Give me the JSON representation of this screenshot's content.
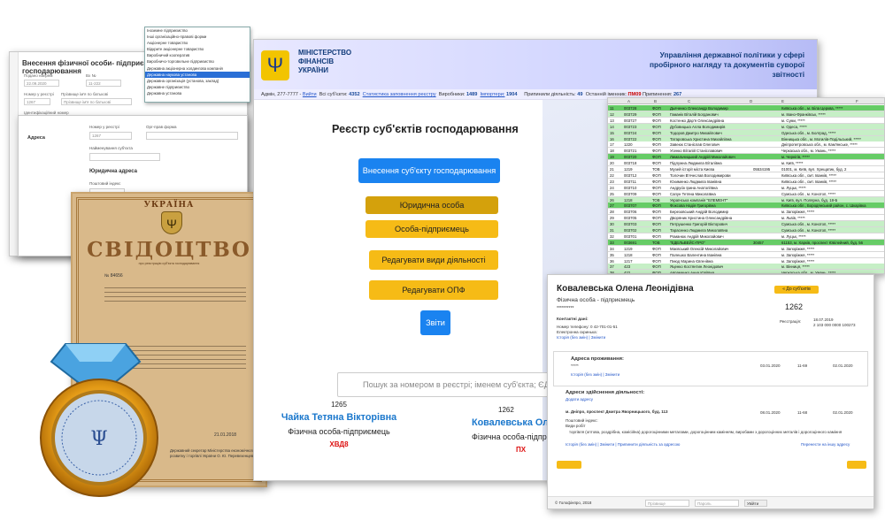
{
  "form_window": {
    "title": "Внесення фізичної особи- підприємця до реєстру суб'єктів господарювання",
    "fields": [
      {
        "label": "Подано напрям",
        "value": "22.09.2020"
      },
      {
        "label": "Вх №",
        "value": "11-222"
      },
      {
        "label": "Номер у реєстрі",
        "value": "1267"
      },
      {
        "label": "Прізвище ім'я по батькові",
        "value": "Прізвище ім'я по батькові"
      },
      {
        "label": "Ідентифікаційний номер",
        "value": "Серія, номер паспорту або УНЗР, ким виданий"
      }
    ]
  },
  "form_window2": {
    "registry_label": "Номер у реєстрі",
    "registry_value": "1267",
    "org_form_label": "Орг-прав форма",
    "address_label": "Адреса",
    "name_label": "Найменування суб'єкта",
    "legal_address": "Юридична адреса",
    "postal_index": "Поштовий індекс",
    "dropdown_options": [
      "Іноземне підприємство",
      "Інші організаційно-правові форми",
      "Акціонерне товариство",
      "Відкрите акціонерне товариство",
      "Виробничий кооператив",
      "Виробничо-торговельне підприємство",
      "Державна акціонерна холдингова компанія",
      "Державна наукова установа",
      "Державна організація (установа, заклад)",
      "Державне підприємство",
      "Державна установа"
    ],
    "selected_index": 7
  },
  "certificate": {
    "country": "УКРАЇНА",
    "title": "СВІДОЦТВО",
    "subtitle": "про реєстрацію суб'єкта господарювання",
    "number": "№ 84656",
    "date": "21.01.2018",
    "signatory": "Державний секретар Міністерства економічного розвитку і торгівлі України О. Ю. Перевезенцев"
  },
  "main_window": {
    "ministry": "МІНІСТЕРСТВО ФІНАНСІВ УКРАЇНИ",
    "department": "Управління державної політики у сфері пробірного нагляду та документів суворої звітності",
    "status": {
      "admin_label": "Адмін, 277-7777 -",
      "logout": "Вийти",
      "entities_label": "Всі суб'єкти:",
      "entities_count": "4352",
      "stats_link": "Статистика заповнення реєстру",
      "producers_label": "Виробники:",
      "producers_count": "1489",
      "importers_label": "Імпортери:",
      "importers_count": "1904",
      "suspended_label": "Припинили діяльність:",
      "suspended_count": "49",
      "last_label": "Останній іменник:",
      "last_value": "ПМ09",
      "terminated_label": "Припинення:",
      "terminated_count": "267"
    },
    "page_title": "Реєстр суб'єктів господарювання",
    "buttons": {
      "add_entity": "Внесення суб'єкту господарювання",
      "legal_entity": "Юридична особа",
      "individual": "Особа-підприємець",
      "edit_activities": "Редагувати види діяльності",
      "edit_opf": "Редагувати ОПФ",
      "reports": "Звіти"
    },
    "search_placeholder": "Пошук за номером в реєстрі; іменем суб'єкта; ЄДРП",
    "cards": [
      {
        "id": "1265",
        "name": "Чайка Тетяна Вікторівна",
        "type": "Фізична особа-підприємець",
        "code": "ХВД8"
      },
      {
        "id": "1262",
        "name": "Ковалевська Олена Ле",
        "type": "Фізична особа-підприєм",
        "code": "ПХ"
      }
    ]
  },
  "spreadsheet": {
    "columns": [
      "A",
      "B",
      "C",
      "D",
      "E",
      "F"
    ],
    "rows": [
      {
        "n": "11",
        "id": "003728",
        "form": "ФОП",
        "name": "Дьяченко Олександр Володимир",
        "code": "",
        "addr": "Київська обл., м. Біла Церква, *****",
        "c": "g"
      },
      {
        "n": "12",
        "id": "003729",
        "form": "ФОП",
        "name": "Гаманік Віталій Богданович",
        "code": "",
        "addr": "м. Івано-Франківськ, *****",
        "c": "lg"
      },
      {
        "n": "13",
        "id": "003727",
        "form": "ФОП",
        "name": "Костенко Дар'я Олександрівна",
        "code": "",
        "addr": "м. Суми, *****",
        "c": "w"
      },
      {
        "n": "14",
        "id": "003723",
        "form": "ФОП",
        "name": "Дубовицька Алла Володимирів",
        "code": "",
        "addr": "м. Одеса, *****",
        "c": "lg"
      },
      {
        "n": "15",
        "id": "003724",
        "form": "ФОП",
        "name": "Тодоров Дмитро Михайлович",
        "code": "",
        "addr": "Одеська обл., м. Болград, *****",
        "c": "lg"
      },
      {
        "n": "16",
        "id": "003722",
        "form": "ФОП",
        "name": "Татаровська Христина Михайлівна",
        "code": "",
        "addr": "Вінницька обл., м. Могилів-Подільський, *****",
        "c": "lg"
      },
      {
        "n": "17",
        "id": "1220",
        "form": "ФОП",
        "name": "Завеюк Станіслав Олегович",
        "code": "",
        "addr": "Дніпропетровська обл., м. Кам'янське, *****",
        "c": "w"
      },
      {
        "n": "18",
        "id": "003721",
        "form": "ФОП",
        "name": "Усенко Віталій Станіславович",
        "code": "",
        "addr": "Черкаська обл., м. Умань, *****",
        "c": "w"
      },
      {
        "n": "19",
        "id": "003720",
        "form": "ФОП",
        "name": "Лимальчицький Андрій Миколайович",
        "code": "",
        "addr": "м. Чернігів, *****",
        "c": "g"
      },
      {
        "n": "20",
        "id": "003718",
        "form": "ФОП",
        "name": "Підлужна Людмила Віталівна",
        "code": "",
        "addr": "м. Київ, *****",
        "c": "w"
      },
      {
        "n": "21",
        "id": "1219",
        "form": "ТОВ",
        "name": "Музей історії міста Києва",
        "code": "05534195",
        "addr": "01001, м. Київ, вул. Хрещатик, буд. 2",
        "c": "w"
      },
      {
        "n": "22",
        "id": "003712",
        "form": "ФОП",
        "name": "Толочин В'ячеслав Володимирови",
        "code": "",
        "addr": "Київська обл., смт. Іванків, *****",
        "c": "w"
      },
      {
        "n": "23",
        "id": "003711",
        "form": "ФОП",
        "name": "Юхименко Людмила Іванівна",
        "code": "",
        "addr": "Київська обл., смт. Іванків, *****",
        "c": "w"
      },
      {
        "n": "24",
        "id": "003710",
        "form": "ФОП",
        "name": "Андрусік Ірина Анатоліївна",
        "code": "",
        "addr": "м. Луцьк, *****",
        "c": "w"
      },
      {
        "n": "25",
        "id": "003709",
        "form": "ФОП",
        "name": "Сапун Тетяна Миколаївна",
        "code": "",
        "addr": "Сумська обл., м. Конотоп, *****",
        "c": "w"
      },
      {
        "n": "26",
        "id": "1218",
        "form": "ТОВ",
        "name": "Українська компанія \"ЕЛЕМЕНТ\"",
        "code": "",
        "addr": "м. Київ, вул. Полярна, буд. 18-Б",
        "c": "lg"
      },
      {
        "n": "27",
        "id": "003707",
        "form": "ФОП",
        "name": "Фоксова Надія Григорівна",
        "code": "",
        "addr": "Київська обл., Бородянський район, с. Шкарівка",
        "c": "g"
      },
      {
        "n": "28",
        "id": "003706",
        "form": "ФОП",
        "name": "Березовський Андрій Володимир",
        "code": "",
        "addr": "м. Запоріжжя, *****",
        "c": "w"
      },
      {
        "n": "29",
        "id": "003705",
        "form": "ФОП",
        "name": "Дворяник Христина Олександрівна",
        "code": "",
        "addr": "м. Львів, *****",
        "c": "w"
      },
      {
        "n": "30",
        "id": "003703",
        "form": "ФОП",
        "name": "Петрушенко Григорій Вікторович",
        "code": "",
        "addr": "Сумська обл., м. Конотоп, *****",
        "c": "lg"
      },
      {
        "n": "31",
        "id": "003702",
        "form": "ФОП",
        "name": "Тарасенко Людмила Миколаївна",
        "code": "",
        "addr": "Сумська обл., м. Конотоп, *****",
        "c": "lg"
      },
      {
        "n": "32",
        "id": "003701",
        "form": "ФОП",
        "name": "Романюк Андрій Миколайович",
        "code": "",
        "addr": "м. Луцьк, *****",
        "c": "w"
      },
      {
        "n": "33",
        "id": "003691",
        "form": "ТОВ",
        "name": "\"ЕДЕЛЬВЕЙС-ПРО\"",
        "code": "30457",
        "addr": "61153, м. Харків, проспект Ювілейний, буд. 56",
        "c": "g"
      },
      {
        "n": "34",
        "id": "1219",
        "form": "ФОП",
        "name": "Маєвський Олексій Миколайович",
        "code": "",
        "addr": "м. Запоріжжя, *****",
        "c": "w"
      },
      {
        "n": "35",
        "id": "1218",
        "form": "ФОП",
        "name": "Палешко Валентина Іванівна",
        "code": "",
        "addr": "м. Запоріжжя, *****",
        "c": "w"
      },
      {
        "n": "36",
        "id": "1217",
        "form": "ФОП",
        "name": "Пиюд Марина Євгенівна",
        "code": "",
        "addr": "м. Запоріжжя, *****",
        "c": "w"
      },
      {
        "n": "37",
        "id": "423",
        "form": "ФОП",
        "name": "Яценко Костянтин Леонідович",
        "code": "",
        "addr": "м. Вінниця, *****",
        "c": "lg"
      },
      {
        "n": "38",
        "id": "422",
        "form": "ФОП",
        "name": "Авраменко Анна Юріївна",
        "code": "",
        "addr": "Черкаська обл., м. Умань, *****",
        "c": "lg"
      }
    ]
  },
  "detail_card": {
    "name": "Ковалевська Олена Леонідівна",
    "type": "Фізична особа - підприємець",
    "masked": "**********",
    "all_entities_btn": "« До суб'єктів",
    "number": "1262",
    "contacts_label": "Контактні дані:",
    "phone": "Номер телефону: 0 42-701-01-51",
    "email_label": "Електронна скринька:",
    "history_links": "Історія (без змін) | Змінити",
    "registry_label": "Реєстрація:",
    "registry_date": "18.07.2019",
    "registry_code": "2 103 000 0000 100273",
    "residence_label": "Адреса проживання:",
    "residence_value": "*****",
    "residence_date1": "03.01.2020",
    "residence_code": "11-69",
    "residence_date2": "02.01.2020",
    "activity_label": "Адреси здійснення діяльності:",
    "add_address": "Додати адресу",
    "activity_addr": "м. Дніпро, проспект Дмитра Яворницького, буд. 113",
    "activity_date1": "08.01.2020",
    "activity_code": "11-68",
    "activity_date2": "02.01.2020",
    "index_label": "Поштовий індекс:",
    "kinds_label": "Види робіт",
    "kinds_value": "торгівля (оптова, роздрібна, комісійна) дорогоцінними металами, дорогоцінним камінням, виробами з дорогоцінних металів і дорогоцінного каміння",
    "bottom_links": "Історія (без змін) | Змінити | Припинити діяльність за адресою",
    "transfer_link": "Перенести на іншу адресу",
    "footer": "© Голофінпро, 2018",
    "login_placeholder": "Прізвище",
    "pass_placeholder": "Пароль",
    "login_btn": "Увійти"
  }
}
